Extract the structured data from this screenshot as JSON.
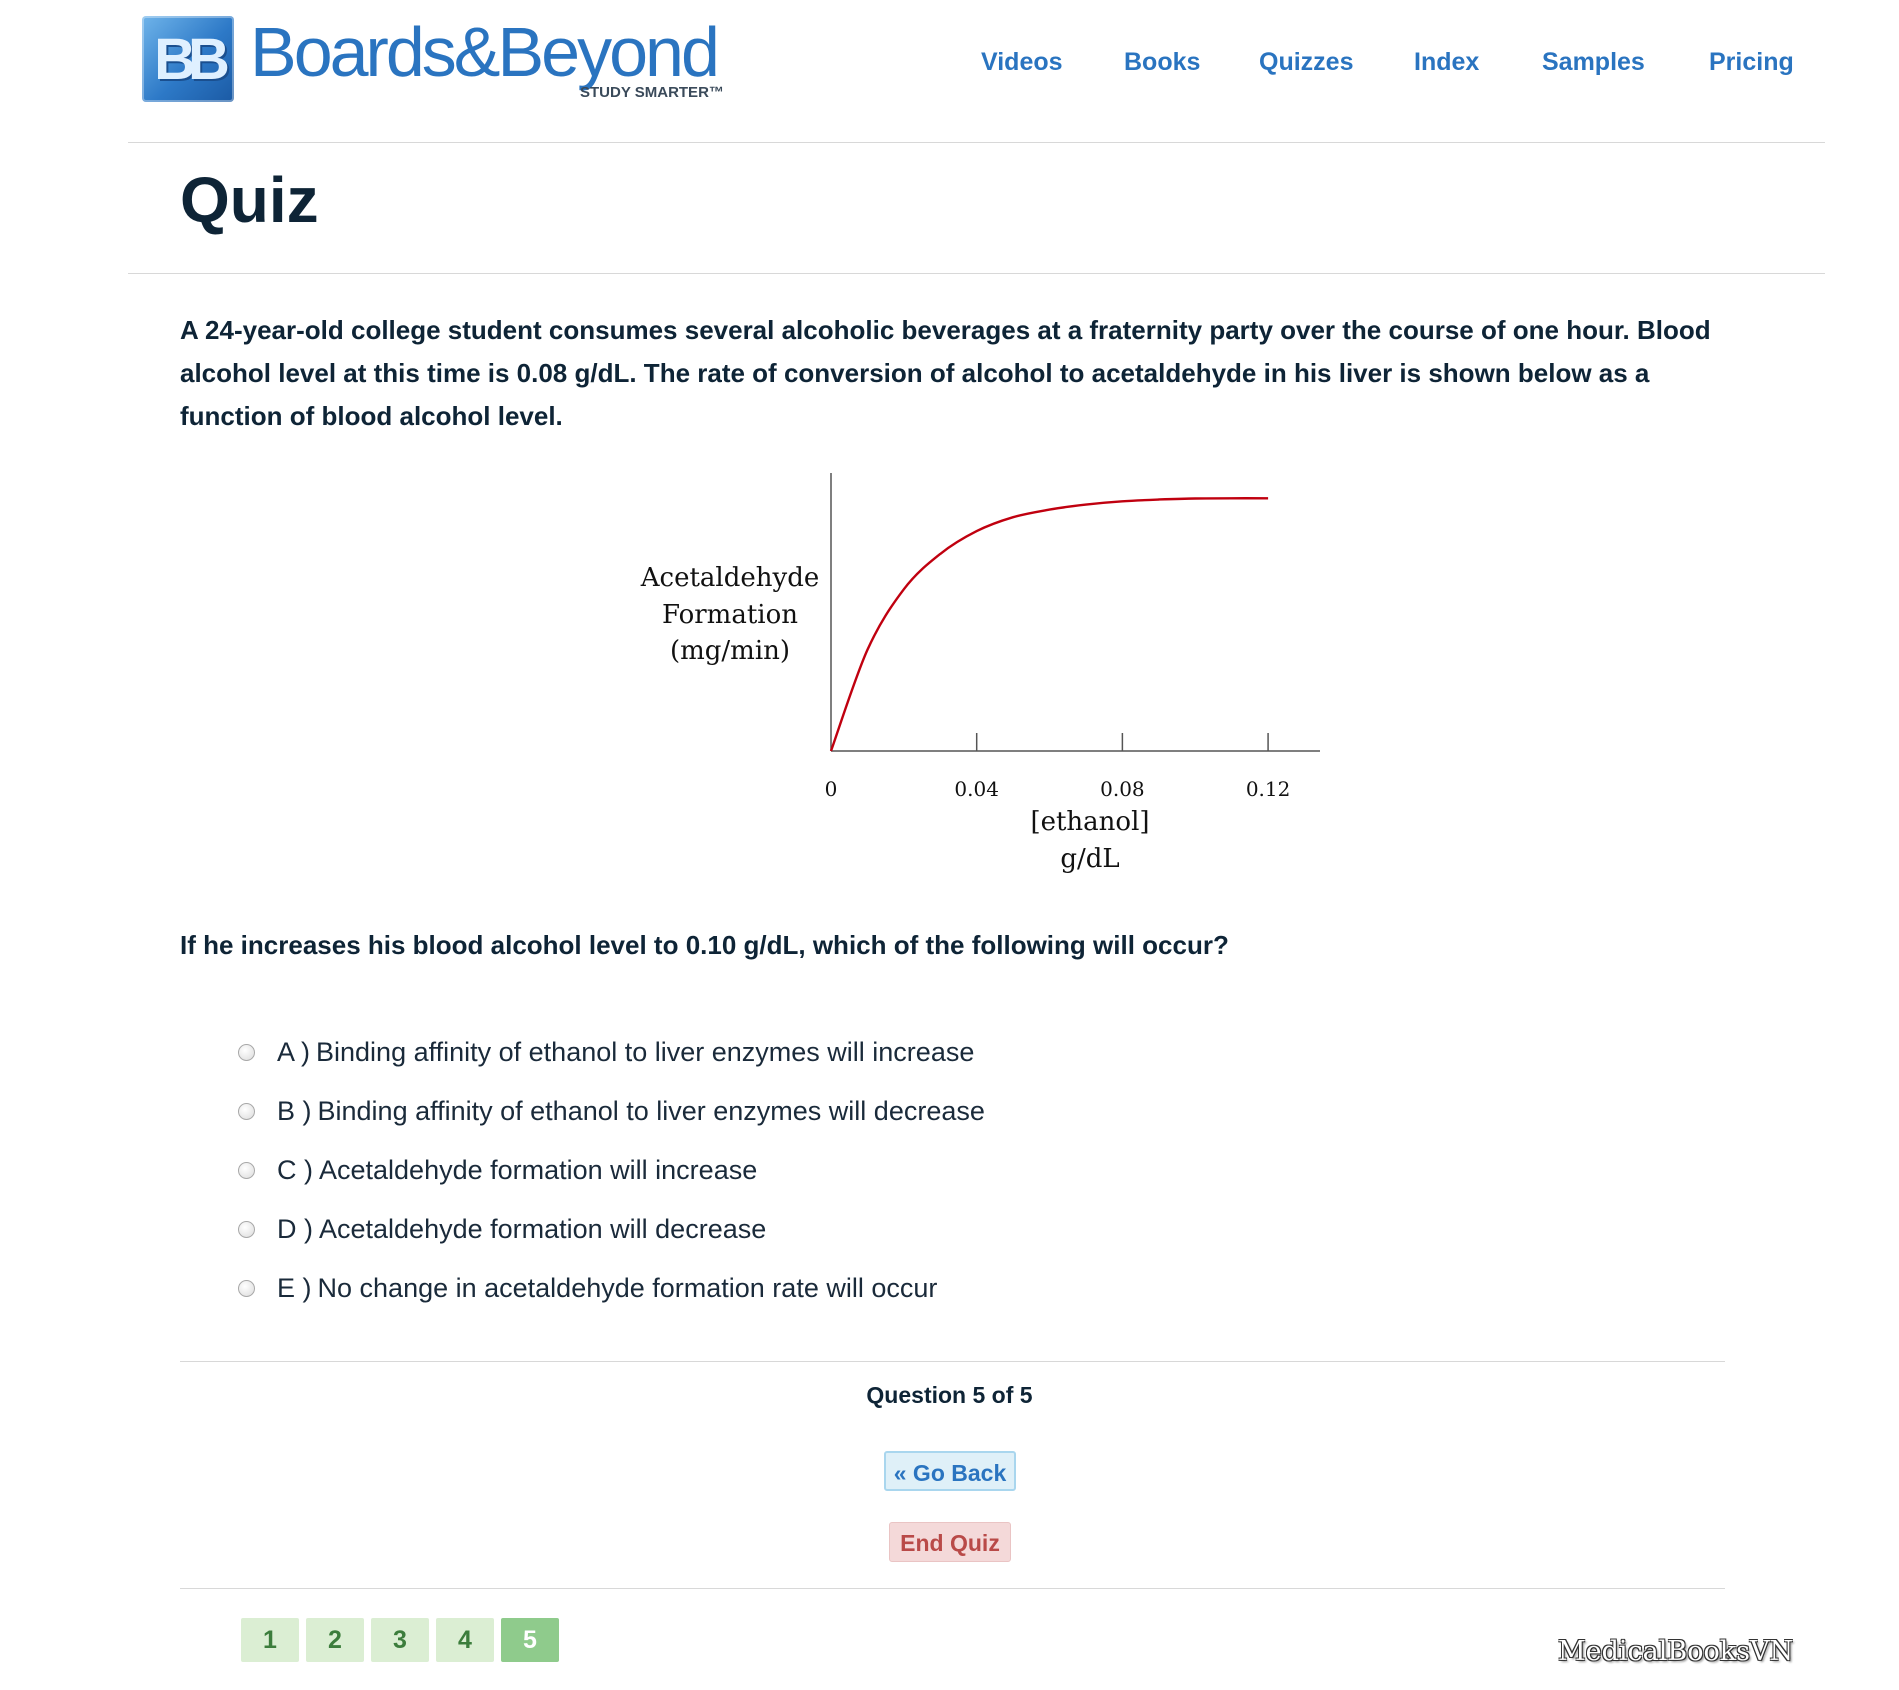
{
  "header": {
    "logo": {
      "mark": "BB",
      "wordmark": "Boards&Beyond",
      "tagline": "STUDY SMARTER™",
      "registered": "®"
    },
    "nav": [
      "Videos",
      "Books",
      "Quizzes",
      "Index",
      "Samples",
      "Pricing"
    ]
  },
  "page": {
    "title": "Quiz"
  },
  "question": {
    "stem": "A 24-year-old college student consumes several alcoholic beverages at a fraternity party over the course of one hour. Blood alcohol level at this time is 0.08 g/dL. The rate of conversion of alcohol to acetaldehyde in his liver is shown below as a function of blood alcohol level.",
    "prompt": "If he increases his blood alcohol level to 0.10 g/dL, which of the following will occur?",
    "answers": [
      {
        "letter": "A )",
        "text": "Binding affinity of ethanol to liver enzymes will increase"
      },
      {
        "letter": "B )",
        "text": "Binding affinity of ethanol to liver enzymes will decrease"
      },
      {
        "letter": "C )",
        "text": "Acetaldehyde formation will increase"
      },
      {
        "letter": "D )",
        "text": "Acetaldehyde formation will decrease"
      },
      {
        "letter": "E )",
        "text": "No change in acetaldehyde formation rate will occur"
      }
    ]
  },
  "chart_data": {
    "type": "line",
    "title": "",
    "ylabel": [
      "Acetaldehyde",
      "Formation",
      "(mg/min)"
    ],
    "xlabel": [
      "[ethanol]",
      "g/dL"
    ],
    "xticks": [
      "0",
      "0.04",
      "0.08",
      "0.12"
    ],
    "xlim": [
      0,
      0.137
    ],
    "ylim": [
      0,
      1.1
    ],
    "grid": false,
    "series": [
      {
        "color": "#c0000f",
        "x": [
          0,
          0.01,
          0.02,
          0.03,
          0.04,
          0.05,
          0.06,
          0.07,
          0.08,
          0.09,
          0.1,
          0.11,
          0.12
        ],
        "y": [
          0,
          0.4,
          0.64,
          0.78,
          0.87,
          0.925,
          0.955,
          0.975,
          0.988,
          0.995,
          0.999,
          1.0,
          1.0
        ]
      }
    ]
  },
  "footer": {
    "progress": "Question 5 of 5",
    "back_label": "« Go Back",
    "end_label": "End Quiz",
    "pages": [
      "1",
      "2",
      "3",
      "4",
      "5"
    ],
    "active_page": "5",
    "watermark": "MedicalBooksVN"
  },
  "colors": {
    "brand": "#2a74c0",
    "heading": "#0e2436",
    "curve": "#c0000f",
    "end": "#b94a48",
    "pager": "#8fcb8c"
  }
}
